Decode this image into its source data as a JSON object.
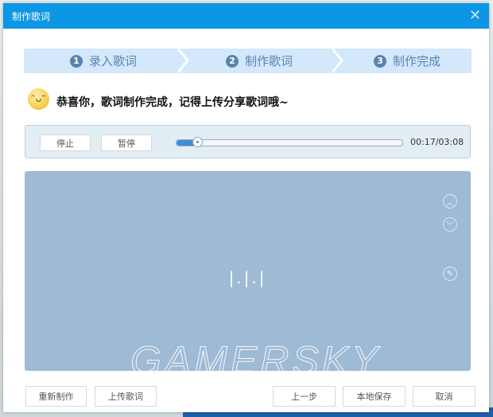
{
  "dialog": {
    "title": "制作歌词",
    "close_icon": "close-icon"
  },
  "steps": [
    {
      "num": "1",
      "label": "录入歌词"
    },
    {
      "num": "2",
      "label": "制作歌词"
    },
    {
      "num": "3",
      "label": "制作完成"
    }
  ],
  "message": {
    "icon": "smile-emoji-icon",
    "text": "恭喜你，歌词制作完成，记得上传分享歌词哦~"
  },
  "player": {
    "stop_label": "停止",
    "pause_label": "暂停",
    "progress_fraction": 0.09,
    "time": "00:17/03:08"
  },
  "lyrics": {
    "text": "|.|.|",
    "icons": [
      "chevron-up-icon",
      "chevron-down-icon",
      "edit-icon"
    ]
  },
  "footer": {
    "redo_label": "重新制作",
    "upload_label": "上传歌词",
    "prev_label": "上一步",
    "save_label": "本地保存",
    "cancel_label": "取消"
  },
  "watermark": "GAMERSKY",
  "colors": {
    "titlebar": "#0d96e3",
    "steps_bg": "#d3e8fa",
    "lyrics_bg": "#9ebad5",
    "accent": "#3d8fd4"
  }
}
